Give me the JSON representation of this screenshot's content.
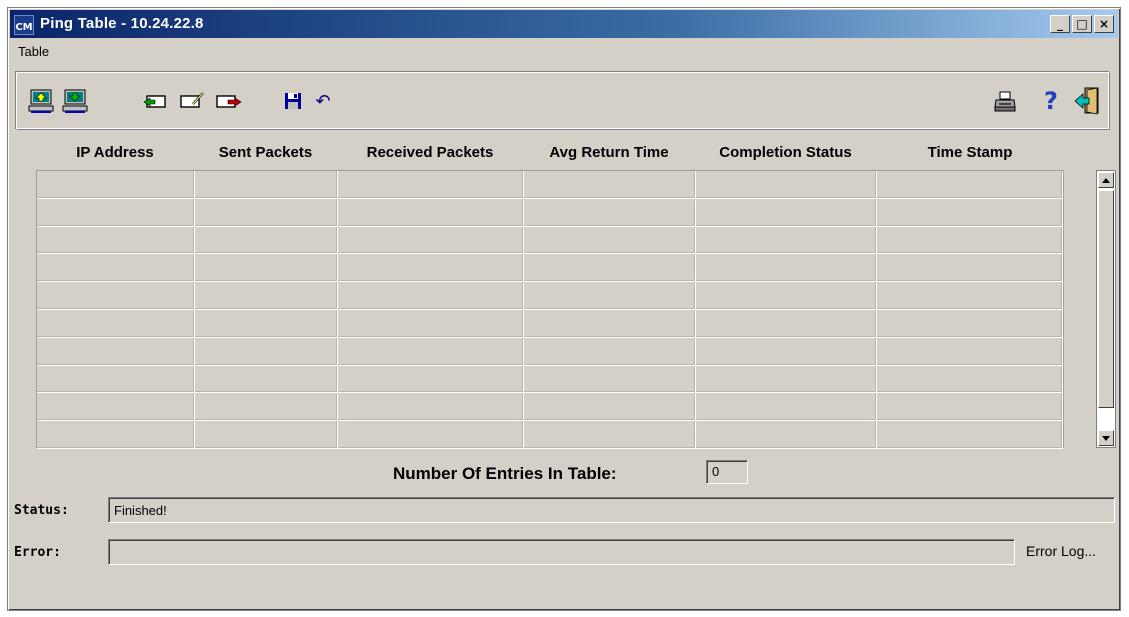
{
  "window": {
    "title": "Ping Table - 10.24.22.8",
    "icon_label": "CM",
    "minimize_glyph": "_",
    "maximize_glyph": "□",
    "close_glyph": "×"
  },
  "menu": {
    "items": [
      "Table"
    ]
  },
  "toolbar": {
    "icons": [
      "upload-computer-icon",
      "download-computer-icon",
      "insert-row-icon",
      "edit-row-icon",
      "export-row-icon",
      "save-icon",
      "undo-icon",
      "print-icon",
      "help-icon",
      "exit-icon"
    ],
    "help_glyph": "?",
    "undo_glyph": "↶"
  },
  "table": {
    "columns": [
      "IP Address",
      "Sent Packets",
      "Received Packets",
      "Avg Return Time",
      "Completion Status",
      "Time Stamp"
    ],
    "rows": 10
  },
  "entries": {
    "label": "Number Of Entries In Table:",
    "value": "0"
  },
  "status": {
    "label": "Status:",
    "value": "Finished!"
  },
  "error": {
    "label": "Error:",
    "value": "",
    "log_link": "Error Log..."
  },
  "colors": {
    "title_gradient_start": "#0a246a",
    "title_gradient_end": "#a6caf0",
    "window_face": "#d4d0c8"
  }
}
